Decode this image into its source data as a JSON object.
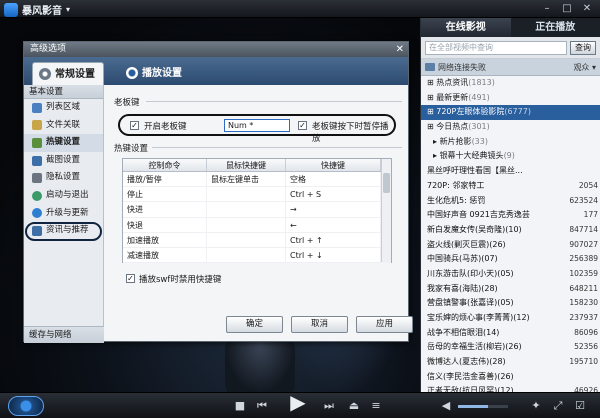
{
  "app": {
    "title": "暴风影音",
    "colors": {
      "accent": "#2a5f9e",
      "title_bar": "#1b1f26",
      "dialog_tabs": "#3b5b80"
    }
  },
  "sidebar": {
    "tabs": [
      "在线影视",
      "正在播放"
    ],
    "search_placeholder": "在全部视频中查询",
    "search_button": "查询",
    "status": "网络连接失败",
    "view_label": "观众",
    "items": [
      {
        "label": "热点资讯",
        "count": "(1813)",
        "kind": "cat"
      },
      {
        "label": "最新更新",
        "count": "(491)",
        "kind": "cat"
      },
      {
        "label": "720P左眼体验影院",
        "count": "(6777)",
        "kind": "sel"
      },
      {
        "label": "今日热点",
        "count": "(301)",
        "kind": "cat"
      },
      {
        "label": "新片抢影",
        "count": "(33)",
        "kind": "sub"
      },
      {
        "label": "银幕十大经典镜头",
        "count": "(9)",
        "kind": "sub"
      },
      {
        "label": "黑丝呼吁理性看国【黑丝...",
        "num": "",
        "kind": "hot"
      },
      {
        "label": "720P: 邻家特工",
        "num": "2054",
        "kind": "hot"
      },
      {
        "label": "生化危机5: 惩罚",
        "num": "623524",
        "kind": "hot"
      },
      {
        "label": "中国好声音 0921吉克秀逸芸",
        "num": "177",
        "kind": "hot"
      },
      {
        "label": "新白发魔女传(吴奇隆)(10)",
        "num": "847714",
        "kind": "hot"
      },
      {
        "label": "盗火线(剿灭巨震)(26)",
        "num": "907027",
        "kind": "hot"
      },
      {
        "label": "中国骑兵(马苏)(07)",
        "num": "256389",
        "kind": "hot"
      },
      {
        "label": "川东游击队(印小天)(05)",
        "num": "102359",
        "kind": "hot"
      },
      {
        "label": "我家有喜(海陆)(28)",
        "num": "648211",
        "kind": "hot"
      },
      {
        "label": "营盘镇警事(张嘉译)(05)",
        "num": "158230",
        "kind": "hot"
      },
      {
        "label": "宝乐婶的烦心事(李菁菁)(12)",
        "num": "237937",
        "kind": "hot"
      },
      {
        "label": "战争不相信眼泪(14)",
        "num": "86096",
        "kind": "hot"
      },
      {
        "label": "岳母的幸福生活(柳岩)(26)",
        "num": "52356",
        "kind": "hot"
      },
      {
        "label": "微博达人(夏志伟)(28)",
        "num": "195710",
        "kind": "hot"
      },
      {
        "label": "信义(李民浩金喜善)(26)",
        "num": "",
        "kind": "hot"
      },
      {
        "label": "正者无敌(抗日风罕)(12)",
        "num": "46926",
        "kind": "hot"
      }
    ]
  },
  "dialog": {
    "title": "高级选项",
    "tabs": [
      "常规设置",
      "播放设置"
    ],
    "nav_header": "基本设置",
    "nav_items": [
      "列表区域",
      "文件关联",
      "热键设置",
      "截图设置",
      "隐私设置",
      "启动与退出",
      "升级与更新",
      "资讯与推荐"
    ],
    "nav_footer": "缓存与网络",
    "boss_key": {
      "section_title": "老板键",
      "enable_label": "开启老板键",
      "key_value": "Num *",
      "pause_label": "老板键按下时暂停播放"
    },
    "hotkeys": {
      "section_title": "热键设置",
      "columns": [
        "控制命令",
        "鼠标快捷键",
        "快捷键"
      ],
      "rows": [
        [
          "播放/暂停",
          "鼠标左键单击",
          "空格"
        ],
        [
          "停止",
          "",
          "Ctrl + S"
        ],
        [
          "快进",
          "",
          "→"
        ],
        [
          "快退",
          "",
          "←"
        ],
        [
          "加速播放",
          "",
          "Ctrl + ↑"
        ],
        [
          "减速播放",
          "",
          "Ctrl + ↓"
        ]
      ],
      "swf_label": "播放swf时禁用快捷键"
    },
    "buttons": {
      "ok": "确定",
      "cancel": "取消",
      "apply": "应用"
    }
  },
  "player": {
    "volume_level": 0.6
  }
}
